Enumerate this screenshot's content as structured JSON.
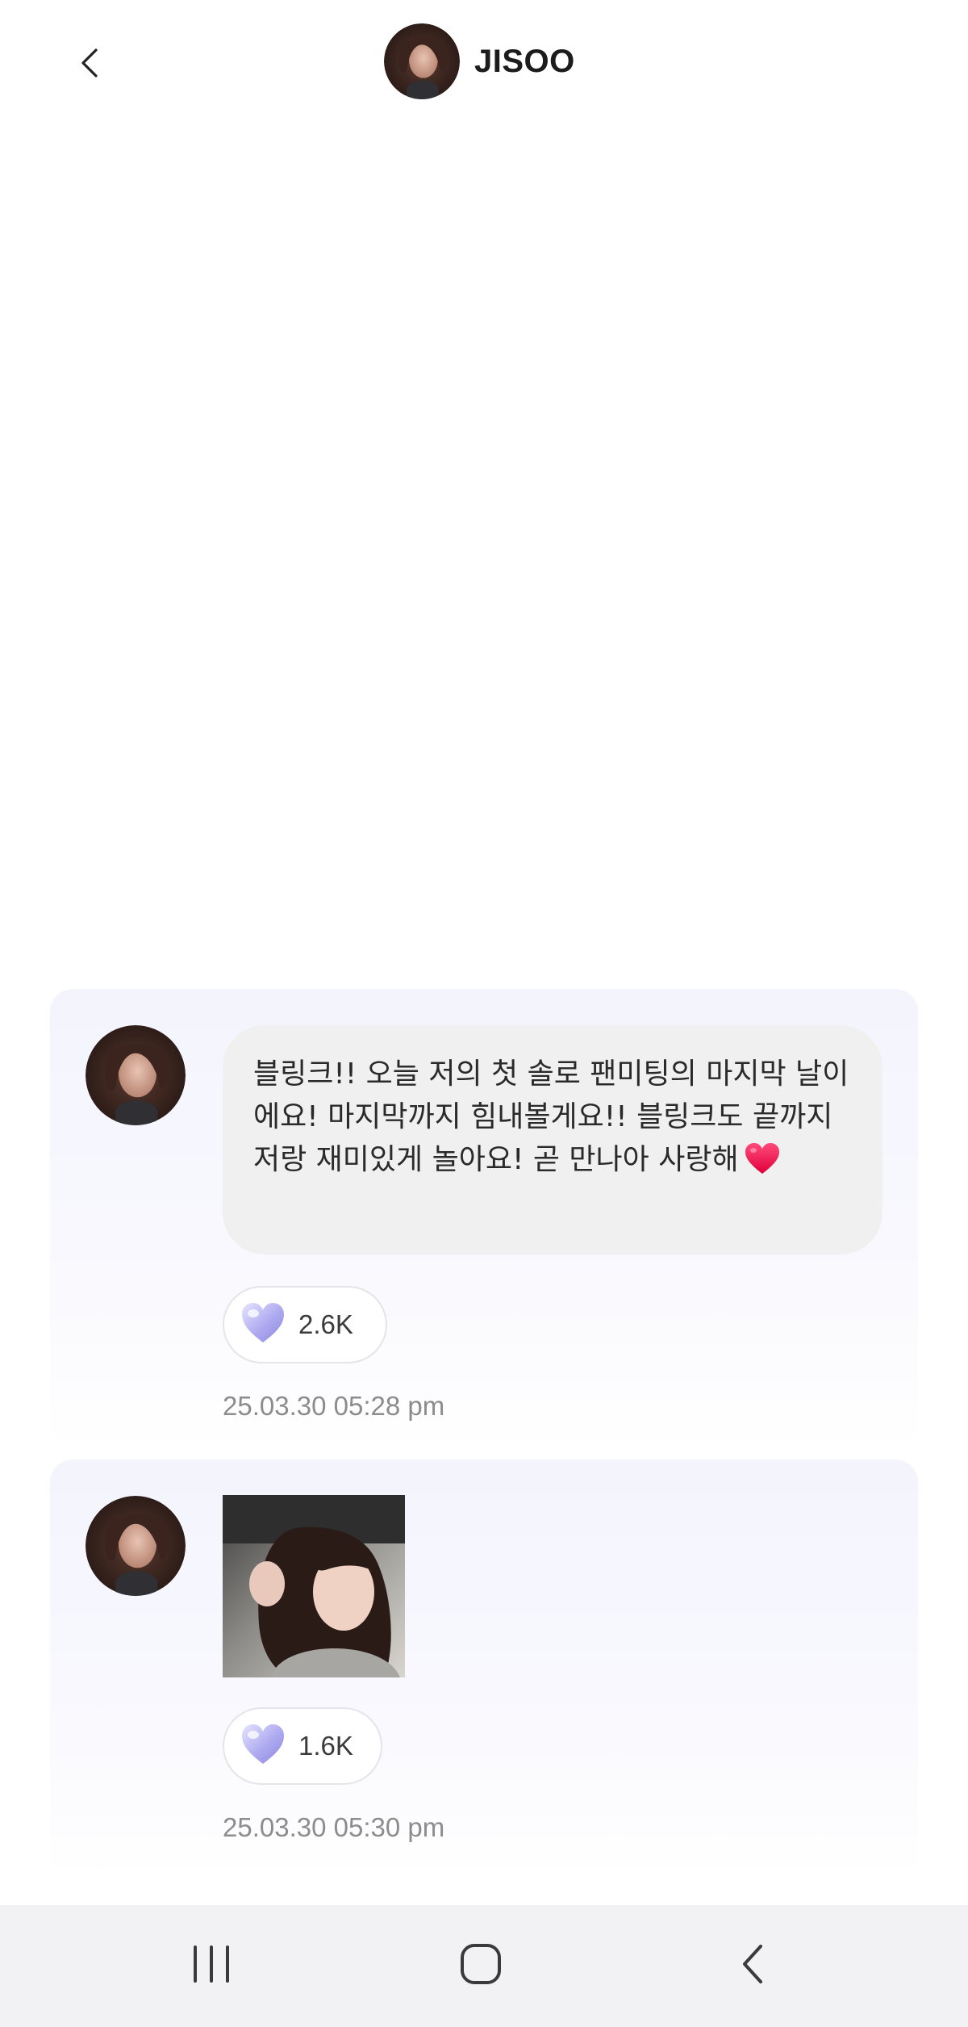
{
  "header": {
    "title": "JISOO",
    "back_icon": "chevron-left-icon"
  },
  "messages": [
    {
      "type": "text",
      "text": "블링크!! 오늘 저의 첫 솔로 팬미팅의 마지막 날이에요! 마지막까지 힘내볼게요!! 블링크도 끝까지 저랑 재미있게 놀아요! 곧 만나아 사랑해",
      "emoji": "heart",
      "likes": "2.6K",
      "timestamp": "25.03.30 05:28 pm"
    },
    {
      "type": "image",
      "likes": "1.6K",
      "timestamp": "25.03.30 05:30 pm"
    }
  ],
  "colors": {
    "card_bg": "#f4f4fd",
    "bubble_bg": "#f0f0f0",
    "heart_red": "#f0194f",
    "like_heart": "#b6b2ee",
    "timestamp": "#8c8c8c",
    "navbar_bg": "#f2f2f4"
  },
  "navbar": {
    "recents_icon": "recents-icon",
    "home_icon": "home-icon",
    "back_icon": "back-icon"
  }
}
